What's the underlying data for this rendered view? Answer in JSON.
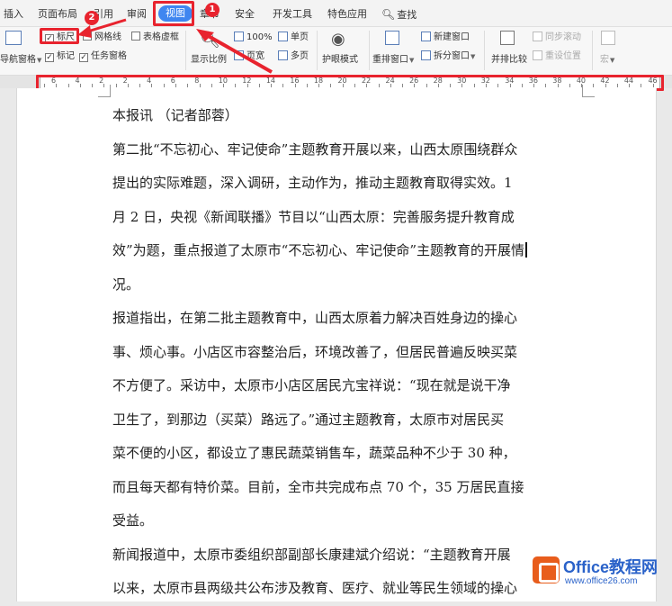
{
  "tabs": [
    {
      "label": "插入"
    },
    {
      "label": "页面布局"
    },
    {
      "label": "引用"
    },
    {
      "label": "审阅"
    },
    {
      "label": "视图"
    },
    {
      "label": "章节"
    },
    {
      "label": "安全"
    },
    {
      "label": "开发工具"
    },
    {
      "label": "特色应用"
    },
    {
      "label": "查找",
      "icon": "search-icon"
    }
  ],
  "ribbon": {
    "nav_pane": "导航窗格",
    "ruler": "标尺",
    "gridlines": "网格线",
    "table_borders": "表格虚框",
    "markup": "标记",
    "task_pane": "任务窗格",
    "zoom_ratio": "显示比例",
    "zoom_100": "100%",
    "single_page": "单页",
    "page_width": "页宽",
    "multi_page": "多页",
    "eye_mode": "护眼模式",
    "rearrange": "重排窗口",
    "new_window": "新建窗口",
    "split": "拆分窗口",
    "side_by_side": "并排比较",
    "sync_scroll": "同步滚动",
    "reset_position": "重设位置",
    "macro": "宏"
  },
  "ruler": {
    "labels": [
      "6",
      "4",
      "2",
      "2",
      "4",
      "6",
      "8",
      "10",
      "12",
      "14",
      "16",
      "18",
      "20",
      "22",
      "24",
      "26",
      "28",
      "30",
      "32",
      "34",
      "36",
      "38",
      "40",
      "42",
      "44",
      "46"
    ]
  },
  "callouts": {
    "badge_1": "1",
    "badge_2": "2"
  },
  "document": {
    "lines": [
      "本报讯  （记者部蓉）",
      "第二批“不忘初心、牢记使命”主题教育开展以来，山西太原围绕群众",
      "提出的实际难题，深入调研，主动作为，推动主题教育取得实效。1",
      "月 2 日，央视《新闻联播》节目以“山西太原：完善服务提升教育成",
      "效”为题，重点报道了太原市“不忘初心、牢记使命”主题教育的开展情",
      "况。",
      "报道指出，在第二批主题教育中，山西太原着力解决百姓身边的操心",
      "事、烦心事。小店区市容整治后，环境改善了，但居民普遍反映买菜",
      "不方便了。采访中，太原市小店区居民亢宝祥说：“现在就是说干净",
      "卫生了，到那边（买菜）路远了。”通过主题教育，太原市对居民买",
      "菜不便的小区，都设立了惠民蔬菜销售车，蔬菜品种不少于 30 种，",
      "而且每天都有特价菜。目前，全市共完成布点 70 个，35 万居民直接",
      "受益。",
      "新闻报道中，太原市委组织部副部长康建斌介绍说：“主题教育开展",
      "以来，太原市县两级共公布涉及教育、医疗、就业等民生领域的操心"
    ]
  },
  "watermark": {
    "title": "Office教程网",
    "url": "www.office26.com"
  },
  "colors": {
    "accent": "#3f86f0",
    "annotation": "#e8232e",
    "watermark": "#2a62c9"
  }
}
